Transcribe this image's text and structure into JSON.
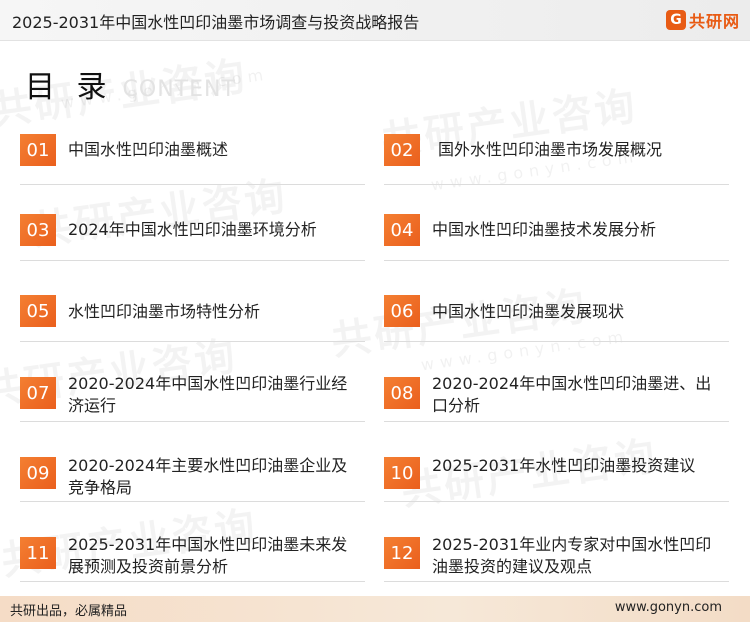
{
  "header": {
    "title": "2025-2031年中国水性凹印油墨市场调查与投资战略报告",
    "logo_mark": "G",
    "logo_text": "共研网"
  },
  "toc": {
    "title": "目 录",
    "subtitle": "CONTENT",
    "items": [
      {
        "num": "01",
        "label": "中国水性凹印油墨概述"
      },
      {
        "num": "02",
        "label": "国外水性凹印油墨市场发展概况"
      },
      {
        "num": "03",
        "label": "2024年中国水性凹印油墨环境分析"
      },
      {
        "num": "04",
        "label": "中国水性凹印油墨技术发展分析"
      },
      {
        "num": "05",
        "label": "水性凹印油墨市场特性分析"
      },
      {
        "num": "06",
        "label": "中国水性凹印油墨发展现状"
      },
      {
        "num": "07",
        "label": "2020-2024年中国水性凹印油墨行业经济运行"
      },
      {
        "num": "08",
        "label": "2020-2024年中国水性凹印油墨进、出口分析"
      },
      {
        "num": "09",
        "label": "2020-2024年主要水性凹印油墨企业及竞争格局"
      },
      {
        "num": "10",
        "label": "2025-2031年水性凹印油墨投资建议"
      },
      {
        "num": "11",
        "label": "2025-2031年中国水性凹印油墨未来发展预测及投资前景分析"
      },
      {
        "num": "12",
        "label": "2025-2031年业内专家对中国水性凹印油墨投资的建议及观点"
      }
    ]
  },
  "watermark": {
    "text": "共研产业咨询",
    "url": "www.gonyn.com"
  },
  "footer": {
    "slogan": "共研出品，必属精品",
    "url": "www.gonyn.com"
  },
  "colors": {
    "accent": "#ea5f1d",
    "footer_bg": "#f6e2cf"
  }
}
